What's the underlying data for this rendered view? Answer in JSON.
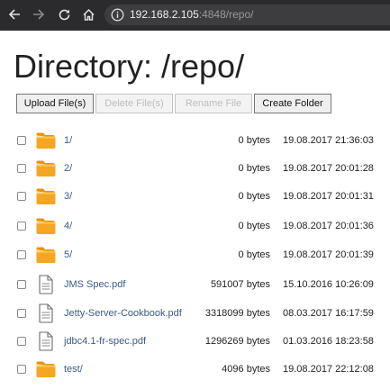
{
  "browser": {
    "address_host": "192.168.2.105",
    "address_rest": ":4848/repo/"
  },
  "page": {
    "title": "Directory: /repo/"
  },
  "toolbar": {
    "upload_label": "Upload File(s)",
    "delete_label": "Delete File(s)",
    "rename_label": "Rename File",
    "create_folder_label": "Create Folder"
  },
  "files": [
    {
      "name": "1/",
      "type": "folder",
      "size": "0 bytes",
      "modified": "19.08.2017 21:36:03"
    },
    {
      "name": "2/",
      "type": "folder",
      "size": "0 bytes",
      "modified": "19.08.2017 20:01:28"
    },
    {
      "name": "3/",
      "type": "folder",
      "size": "0 bytes",
      "modified": "19.08.2017 20:01:31"
    },
    {
      "name": "4/",
      "type": "folder",
      "size": "0 bytes",
      "modified": "19.08.2017 20:01:36"
    },
    {
      "name": "5/",
      "type": "folder",
      "size": "0 bytes",
      "modified": "19.08.2017 20:01:39"
    },
    {
      "name": "JMS Spec.pdf",
      "type": "file",
      "size": "591007 bytes",
      "modified": "15.10.2016 10:26:09"
    },
    {
      "name": "Jetty-Server-Cookbook.pdf",
      "type": "file",
      "size": "3318099 bytes",
      "modified": "08.03.2017 16:17:59"
    },
    {
      "name": "jdbc4.1-fr-spec.pdf",
      "type": "file",
      "size": "1296269 bytes",
      "modified": "01.03.2016 18:23:58"
    },
    {
      "name": "test/",
      "type": "folder",
      "size": "4096 bytes",
      "modified": "19.08.2017 22:12:08"
    }
  ],
  "colors": {
    "browser_bar": "#2b2b2d",
    "link": "#3a5a8a",
    "folder": "#f5a623"
  }
}
